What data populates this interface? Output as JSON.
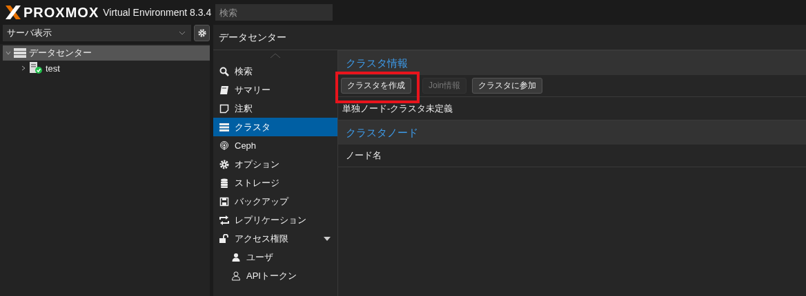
{
  "header": {
    "logo": "PROXMOX",
    "product": "Virtual Environment 8.3.4",
    "search": {
      "placeholder": "検索"
    }
  },
  "sidebar": {
    "view_select": "サーバ表示",
    "tree": [
      {
        "label": "データセンター",
        "selected": true,
        "expanded": true,
        "children": [
          {
            "label": "test",
            "selected": false,
            "expanded": false
          }
        ]
      }
    ]
  },
  "breadcrumb": "データセンター",
  "menu": [
    {
      "label": "検索",
      "selected": false
    },
    {
      "label": "サマリー",
      "selected": false
    },
    {
      "label": "注釈",
      "selected": false
    },
    {
      "label": "クラスタ",
      "selected": true
    },
    {
      "label": "Ceph",
      "selected": false
    },
    {
      "label": "オプション",
      "selected": false
    },
    {
      "label": "ストレージ",
      "selected": false
    },
    {
      "label": "バックアップ",
      "selected": false
    },
    {
      "label": "レプリケーション",
      "selected": false
    },
    {
      "label": "アクセス権限",
      "selected": false,
      "expanded": true,
      "children": [
        {
          "label": "ユーザ",
          "selected": false
        },
        {
          "label": "APIトークン",
          "selected": false
        }
      ]
    }
  ],
  "cluster_info": {
    "title": "クラスタ情報",
    "buttons": [
      {
        "label": "クラスタを作成",
        "disabled": false,
        "highlighted": true
      },
      {
        "label": "Join情報",
        "disabled": true,
        "highlighted": false
      },
      {
        "label": "クラスタに参加",
        "disabled": false,
        "highlighted": false
      }
    ],
    "status": "単独ノード-クラスタ未定義"
  },
  "cluster_nodes": {
    "title": "クラスタノード",
    "columns": [
      "ノード名"
    ]
  }
}
